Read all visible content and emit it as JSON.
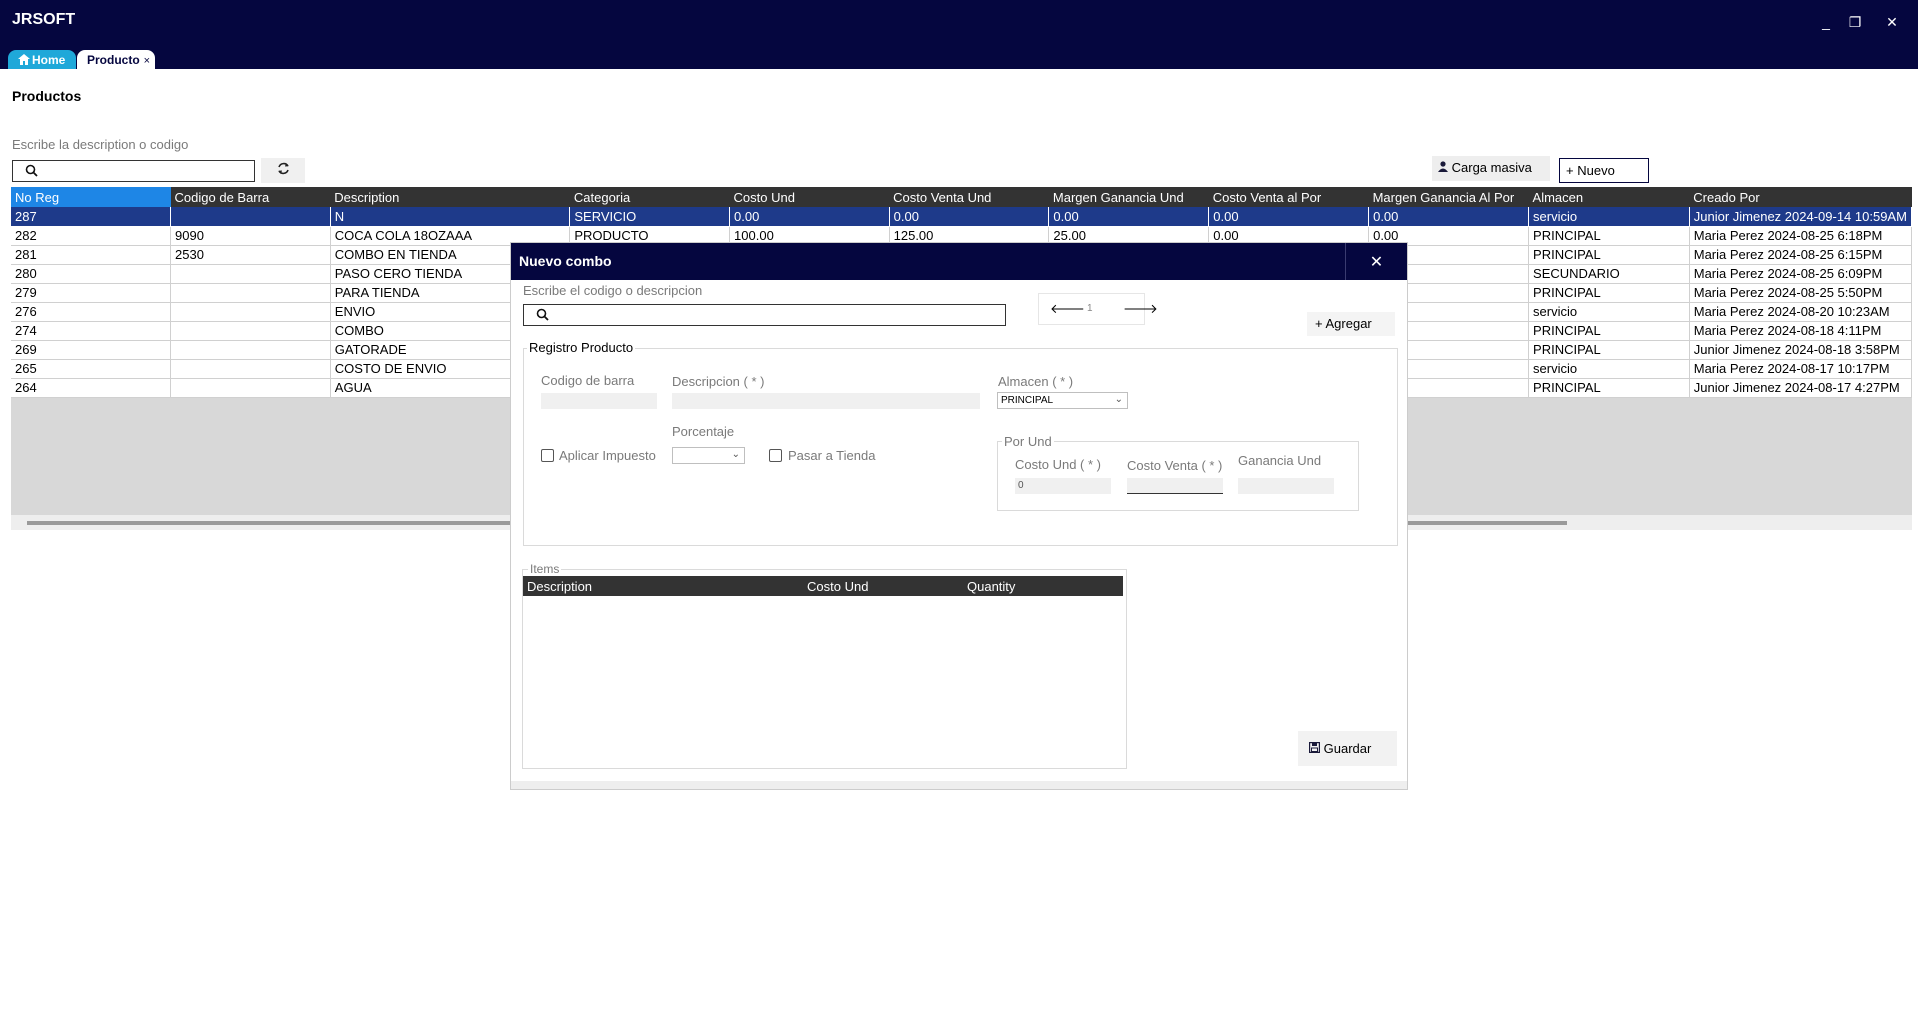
{
  "window": {
    "title": "JRSOFT",
    "controls": {
      "minimize": "_",
      "restore": "❐",
      "close": "✕"
    }
  },
  "tabs": [
    {
      "label": "Home",
      "icon": "home-icon"
    },
    {
      "label": "Producto",
      "close": "×"
    }
  ],
  "page": {
    "title": "Productos",
    "search_label": "Escribe la description o codigo",
    "search_value": "",
    "carga_label": "Carga masiva",
    "nuevo_label": "Nuevo"
  },
  "grid": {
    "columns": [
      "No Reg",
      "Codigo de Barra",
      "Description",
      "Categoria",
      "Costo Und",
      "Costo Venta Und",
      "Margen Ganancia Und",
      "Costo Venta al Por",
      "Margen Ganancia Al Por",
      "Almacen",
      "Creado Por"
    ],
    "rows": [
      [
        "287",
        "",
        "N",
        "SERVICIO",
        "0.00",
        "0.00",
        "0.00",
        "0.00",
        "0.00",
        "servicio",
        "Junior Jimenez 2024-09-14 10:59AM"
      ],
      [
        "282",
        "9090",
        "COCA COLA 18OZAAA",
        "PRODUCTO",
        "100.00",
        "125.00",
        "25.00",
        "0.00",
        "0.00",
        "PRINCIPAL",
        "Maria Perez 2024-08-25 6:18PM"
      ],
      [
        "281",
        "2530",
        "COMBO EN TIENDA",
        "",
        "",
        "",
        "",
        "",
        "",
        "PRINCIPAL",
        "Maria Perez 2024-08-25 6:15PM"
      ],
      [
        "280",
        "",
        "PASO CERO TIENDA",
        "",
        "",
        "",
        "",
        "",
        "",
        "SECUNDARIO",
        "Maria Perez 2024-08-25 6:09PM"
      ],
      [
        "279",
        "",
        "PARA TIENDA",
        "",
        "",
        "",
        "",
        "",
        "",
        "PRINCIPAL",
        "Maria Perez 2024-08-25 5:50PM"
      ],
      [
        "276",
        "",
        "ENVIO",
        "",
        "",
        "",
        "",
        "",
        "",
        "servicio",
        "Maria Perez 2024-08-20 10:23AM"
      ],
      [
        "274",
        "",
        "COMBO",
        "",
        "",
        "",
        "",
        "",
        "",
        "PRINCIPAL",
        "Maria Perez 2024-08-18 4:11PM"
      ],
      [
        "269",
        "",
        "GATORADE",
        "",
        "",
        "",
        "",
        "",
        "",
        "PRINCIPAL",
        "Junior Jimenez 2024-08-18 3:58PM"
      ],
      [
        "265",
        "",
        "COSTO DE ENVIO",
        "",
        "",
        "",
        "",
        "",
        "",
        "servicio",
        "Maria Perez 2024-08-17 10:17PM"
      ],
      [
        "264",
        "",
        "AGUA",
        "",
        "",
        "",
        "",
        "",
        "",
        "PRINCIPAL",
        "Junior Jimenez 2024-08-17 4:27PM"
      ]
    ]
  },
  "modal": {
    "title": "Nuevo combo",
    "close": "✕",
    "search_label": "Escribe el codigo o descripcion",
    "search_value": "",
    "pager": {
      "prev": "🡐",
      "page": "1",
      "next": "🡒"
    },
    "agregar_label": "Agregar",
    "registro": {
      "title": "Registro Producto",
      "codigo_label": "Codigo de barra",
      "codigo_value": "",
      "descripcion_label": "Descripcion ( * )",
      "descripcion_value": "",
      "almacen_label": "Almacen ( * )",
      "almacen_value": "PRINCIPAL",
      "porcentaje_label": "Porcentaje",
      "porcentaje_value": "",
      "aplicar_impuesto_label": "Aplicar Impuesto",
      "pasar_tienda_label": "Pasar a Tienda",
      "por_und": {
        "title": "Por Und",
        "costo_und_label": "Costo Und ( * )",
        "costo_und_value": "0",
        "costo_venta_label": "Costo Venta ( * )",
        "costo_venta_value": "",
        "ganancia_label": "Ganancia Und",
        "ganancia_value": ""
      }
    },
    "items": {
      "title": "Items",
      "columns": [
        "Description",
        "Costo Und",
        "Quantity"
      ]
    },
    "guardar_label": "Guardar"
  }
}
